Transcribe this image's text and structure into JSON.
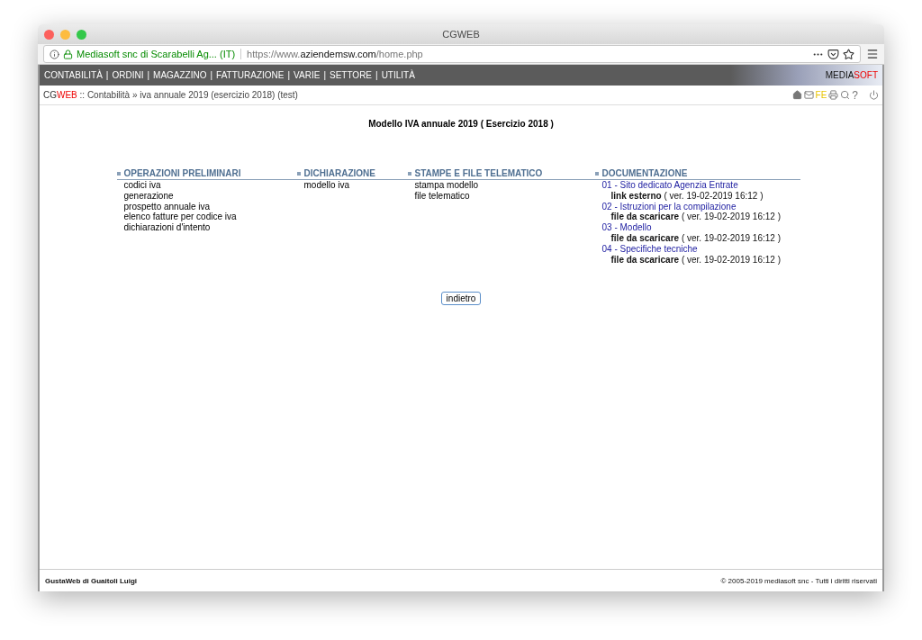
{
  "window": {
    "title": "CGWEB"
  },
  "address_bar": {
    "site_identity": "Mediasoft snc di Scarabelli Ag... (IT)",
    "url": "https://www.**aziendemsw.com**/home.php"
  },
  "menu": {
    "items": [
      "CONTABILITÀ",
      "ORDINI",
      "MAGAZZINO",
      "FATTURAZIONE",
      "VARIE",
      "SETTORE",
      "UTILITÀ"
    ],
    "separator": "|",
    "logo": [
      "MEDIA",
      "SOFT"
    ]
  },
  "breadcrumb": {
    "brand": [
      "CG",
      "WEB"
    ],
    "path": ":: Contabilità » iva annuale 2019 (esercizio 2018) (test)",
    "toolbar_label": "FE",
    "help": "?"
  },
  "page_title": "Modello IVA annuale 2019 ( Esercizio 2018 )",
  "sections": [
    {
      "kind": "menu",
      "heading": "OPERAZIONI PRELIMINARI",
      "items": [
        "codici iva",
        "generazione",
        "prospetto annuale iva",
        "elenco fatture per codice iva",
        "dichiarazioni d'intento"
      ]
    },
    {
      "kind": "menu",
      "heading": "DICHIARAZIONE",
      "items": [
        "modello iva"
      ]
    },
    {
      "kind": "menu",
      "heading": "STAMPE E FILE TELEMATICO",
      "items": [
        "stampa modello",
        "file telematico"
      ]
    },
    {
      "kind": "docs",
      "heading": "DOCUMENTAZIONE",
      "items": [
        {
          "link": "01 - Sito dedicato Agenzia Entrate",
          "type": "link esterno",
          "version": "( ver. 19-02-2019 16:12 )"
        },
        {
          "link": "02 - Istruzioni per la compilazione",
          "type": "file da scaricare",
          "version": "( ver. 19-02-2019 16:12 )"
        },
        {
          "link": "03 - Modello",
          "type": "file da scaricare",
          "version": "( ver. 19-02-2019 16:12 )"
        },
        {
          "link": "04 - Specifiche tecniche",
          "type": "file da scaricare",
          "version": "( ver. 19-02-2019 16:12 )"
        }
      ]
    }
  ],
  "back_button": "indietro",
  "footer": {
    "left": "GustaWeb di Guaitoli Luigi",
    "right": "© 2005-2019 mediasoft snc - Tutti i diritti riservati"
  }
}
